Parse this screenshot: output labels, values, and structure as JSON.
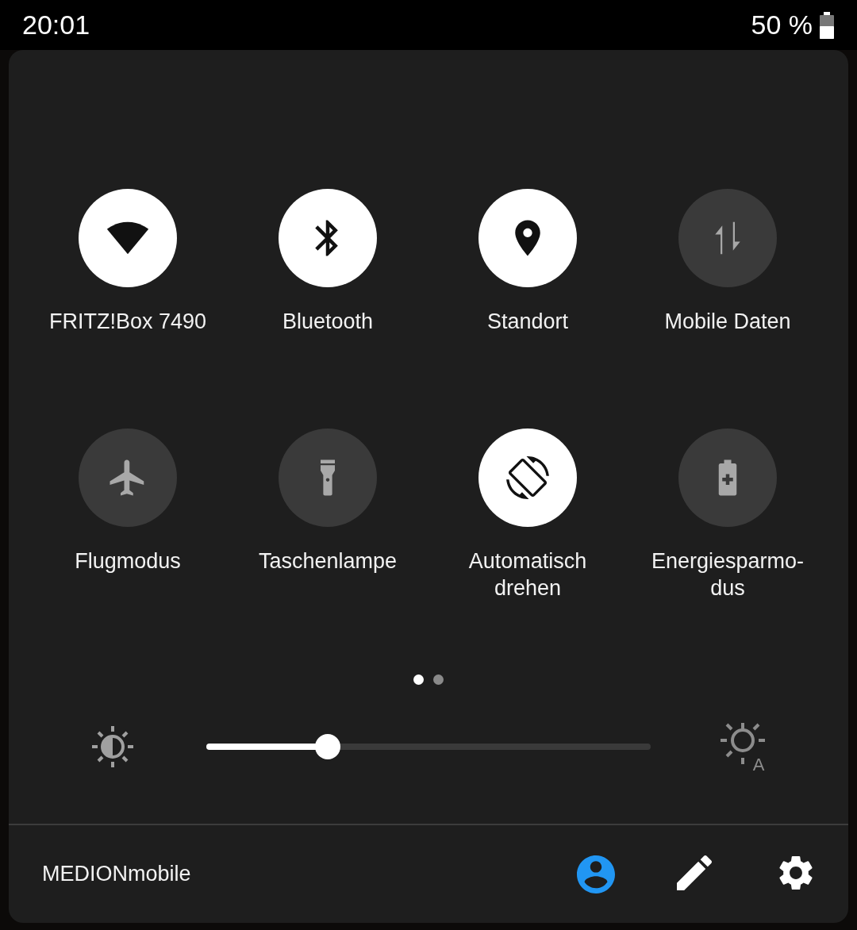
{
  "status_bar": {
    "time": "20:01",
    "battery": "50 %"
  },
  "tiles": [
    {
      "label": "FRITZ!Box 7490",
      "on": true
    },
    {
      "label": "Bluetooth",
      "on": true
    },
    {
      "label": "Standort",
      "on": true
    },
    {
      "label": "Mobile Daten",
      "on": false
    },
    {
      "label": "Flugmodus",
      "on": false
    },
    {
      "label": "Taschenlampe",
      "on": false
    },
    {
      "label": "Automatisch\ndrehen",
      "on": true
    },
    {
      "label": "Energiesparmo-\ndus",
      "on": false
    }
  ],
  "pages": [
    {
      "selected": true
    },
    {
      "selected": false
    }
  ],
  "brightness": {
    "level": 0.273,
    "auto_mark": "A"
  },
  "footer": {
    "operator": "MEDIONmobile"
  }
}
